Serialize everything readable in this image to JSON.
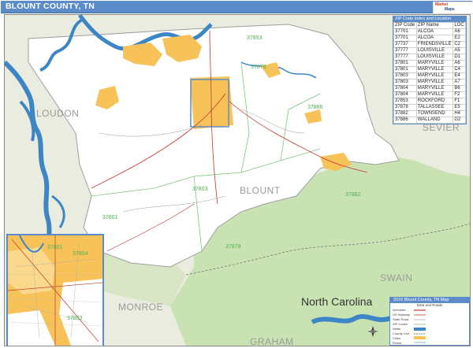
{
  "title": "BLOUNT COUNTY, TN",
  "logo": {
    "line1": "Market",
    "line2": "Maps"
  },
  "counties": {
    "blount": "BLOUNT",
    "loudon": "LOUDON",
    "sevier": "SEVIER",
    "monroe": "MONROE",
    "swain": "SWAIN",
    "graham": "GRAHAM"
  },
  "state_label": "North Carolina",
  "zip_labels": [
    "37853",
    "37878",
    "37886",
    "37803",
    "37882",
    "37801",
    "37878",
    "37801",
    "37804",
    "37803"
  ],
  "zip_table": {
    "header": "ZIP Code Index and Location",
    "columns": [
      "ZIP Code",
      "ZIP Name",
      "LOC"
    ],
    "rows": [
      [
        "37701",
        "ALCOA",
        "A6"
      ],
      [
        "37701",
        "ALCOA",
        "E2"
      ],
      [
        "37737",
        "FRIENDSVILLE",
        "C2"
      ],
      [
        "37777",
        "LOUISVILLE",
        "A5"
      ],
      [
        "37777",
        "LOUISVILLE",
        "D1"
      ],
      [
        "37801",
        "MARYVILLE",
        "A6"
      ],
      [
        "37801",
        "MARYVILLE",
        "C4"
      ],
      [
        "37803",
        "MARYVILLE",
        "E4"
      ],
      [
        "37803",
        "MARYVILLE",
        "A7"
      ],
      [
        "37804",
        "MARYVILLE",
        "B6"
      ],
      [
        "37804",
        "MARYVILLE",
        "F2"
      ],
      [
        "37853",
        "ROCKFORD",
        "F1"
      ],
      [
        "37878",
        "TALLASSEE",
        "E5"
      ],
      [
        "37882",
        "TOWNSEND",
        "H4"
      ],
      [
        "37886",
        "WALLAND",
        "G2"
      ]
    ]
  },
  "legend": {
    "title": "2016 Blount County, TN Map",
    "subtitle": "Data and Roads",
    "items": [
      "Interstate",
      "US Highway",
      "State Road",
      "ZIP Codes",
      "Water",
      "County Line",
      "Cities",
      "Rivers"
    ]
  },
  "colors": {
    "title_bar": "#5b8cc9",
    "county_fill": "#ffffff",
    "neighbor_fill": "#e9ecdf",
    "forest": "#c9e2b2",
    "water": "#3d86c6",
    "city": "#f7c257",
    "zip_label": "#4caf50",
    "roads": "#c0392b"
  }
}
